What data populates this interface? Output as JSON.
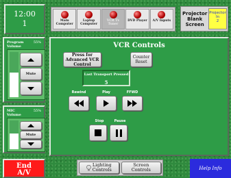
{
  "clock": {
    "time": "12:00",
    "period": "1"
  },
  "sources": [
    {
      "label": "Main Computer",
      "active": false
    },
    {
      "label": "Laptop Computer",
      "active": false
    },
    {
      "label": "VCR Tv Tuner",
      "active": true
    },
    {
      "label": "DVD Player",
      "active": false
    },
    {
      "label": "A/V Inputs",
      "active": false
    }
  ],
  "projector": {
    "blank_label": "Projector Blank Screen",
    "input_title": "Projector",
    "input_label": "In",
    "input_value": "2"
  },
  "program_volume": {
    "title": "Program Volume",
    "percent": "55%",
    "level": 0.55,
    "mute_label": "Mute"
  },
  "mic_volume": {
    "title": "MIC Volume",
    "percent": "55%",
    "level": 0.55,
    "mute_label": "Mute"
  },
  "vcr": {
    "title": "VCR Controls",
    "advanced_label": "Press for Advanced VCR Control",
    "counter_reset_label": "Counter Reset",
    "last_transport_label": "Last Transport Pressed",
    "last_transport_value": "5",
    "rewind_label": "Rewind",
    "play_label": "Play",
    "ffwd_label": "FFWD",
    "stop_label": "Stop",
    "pause_label": "Pause"
  },
  "footer": {
    "end_label_1": "End",
    "end_label_2": "A/V",
    "lighting_label_1": "Lighting",
    "lighting_label_2": "Controls",
    "screen_label_1": "Screen",
    "screen_label_2": "Controls",
    "help_label": "Help Info"
  }
}
